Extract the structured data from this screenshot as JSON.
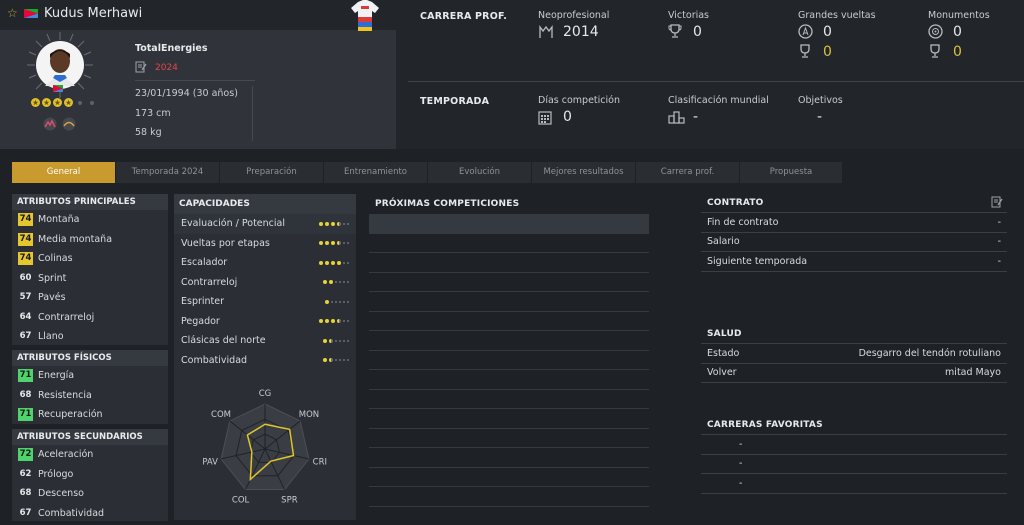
{
  "rider": {
    "name": "Kudus Merhawi",
    "team": "TotalEnergies",
    "contract_year": "2024",
    "birth": "23/01/1994 (30 años)",
    "height": "173 cm",
    "weight": "58 kg",
    "stars": 4,
    "stars_max": 6,
    "flag_colors": [
      "#12ad2b",
      "#ea0437",
      "#4189dd"
    ]
  },
  "career": {
    "title": "CARRERA PROF.",
    "pro_label": "Neoprofesional",
    "pro_value": "2014",
    "wins_label": "Victorias",
    "wins_value": "0",
    "gt_label": "Grandes vueltas",
    "gt_value": "0",
    "gt_sub_value": "0",
    "monuments_label": "Monumentos",
    "monuments_value": "0",
    "monuments_sub_value": "0"
  },
  "season": {
    "title": "TEMPORADA",
    "days_label": "Días competición",
    "days_value": "0",
    "ranking_label": "Clasificación mundial",
    "ranking_value": "-",
    "goals_label": "Objetivos",
    "goals_value": "-"
  },
  "tabs": [
    "General",
    "Temporada 2024",
    "Preparación",
    "Entrenamiento",
    "Evolución",
    "Mejores resultados",
    "Carrera prof.",
    "Propuesta"
  ],
  "main_attrs": {
    "title": "ATRIBUTOS PRINCIPALES",
    "items": [
      {
        "value": "74",
        "label": "Montaña",
        "color": "y"
      },
      {
        "value": "74",
        "label": "Media montaña",
        "color": "y"
      },
      {
        "value": "74",
        "label": "Colinas",
        "color": "y"
      },
      {
        "value": "60",
        "label": "Sprint",
        "color": "n"
      },
      {
        "value": "57",
        "label": "Pavés",
        "color": "n"
      },
      {
        "value": "64",
        "label": "Contrarreloj",
        "color": "n"
      },
      {
        "value": "67",
        "label": "Llano",
        "color": "n"
      }
    ]
  },
  "phys_attrs": {
    "title": "ATRIBUTOS FÍSICOS",
    "items": [
      {
        "value": "71",
        "label": "Energía",
        "color": "g"
      },
      {
        "value": "68",
        "label": "Resistencia",
        "color": "n"
      },
      {
        "value": "71",
        "label": "Recuperación",
        "color": "g"
      }
    ]
  },
  "sec_attrs": {
    "title": "ATRIBUTOS SECUNDARIOS",
    "items": [
      {
        "value": "72",
        "label": "Aceleración",
        "color": "g"
      },
      {
        "value": "62",
        "label": "Prólogo",
        "color": "n"
      },
      {
        "value": "68",
        "label": "Descenso",
        "color": "n"
      },
      {
        "value": "67",
        "label": "Combatividad",
        "color": "n"
      }
    ]
  },
  "capacities": {
    "title": "CAPACIDADES",
    "items": [
      {
        "label": "Evaluación / Potencial",
        "filled": 3,
        "half": 1,
        "off": 2
      },
      {
        "label": "Vueltas por etapas",
        "filled": 3,
        "half": 1,
        "off": 2
      },
      {
        "label": "Escalador",
        "filled": 4,
        "half": 0,
        "off": 2
      },
      {
        "label": "Contrarreloj",
        "filled": 2,
        "half": 0,
        "off": 4
      },
      {
        "label": "Esprinter",
        "filled": 1,
        "half": 0,
        "off": 5
      },
      {
        "label": "Pegador",
        "filled": 3,
        "half": 1,
        "off": 2
      },
      {
        "label": "Clásicas del norte",
        "filled": 1,
        "half": 1,
        "off": 4
      },
      {
        "label": "Combatividad",
        "filled": 1,
        "half": 1,
        "off": 4
      }
    ]
  },
  "radar": {
    "axes": [
      "CG",
      "MON",
      "CRI",
      "SPR",
      "COL",
      "PAV",
      "COM"
    ],
    "values": [
      0.55,
      0.7,
      0.65,
      0.3,
      0.75,
      0.3,
      0.5
    ],
    "color": "#e0c52c"
  },
  "competitions": {
    "title": "PRÓXIMAS COMPETICIONES",
    "rows": 15
  },
  "contract": {
    "title": "CONTRATO",
    "rows": [
      {
        "label": "Fin de contrato",
        "value": "-"
      },
      {
        "label": "Salario",
        "value": "-"
      },
      {
        "label": "Siguiente temporada",
        "value": "-"
      }
    ]
  },
  "health": {
    "title": "SALUD",
    "rows": [
      {
        "label": "Estado",
        "value": "Desgarro del tendón rotuliano"
      },
      {
        "label": "Volver",
        "value": "mitad Mayo"
      }
    ]
  },
  "favorites": {
    "title": "CARRERAS FAVORITAS",
    "rows": [
      "-",
      "-",
      "-"
    ]
  }
}
